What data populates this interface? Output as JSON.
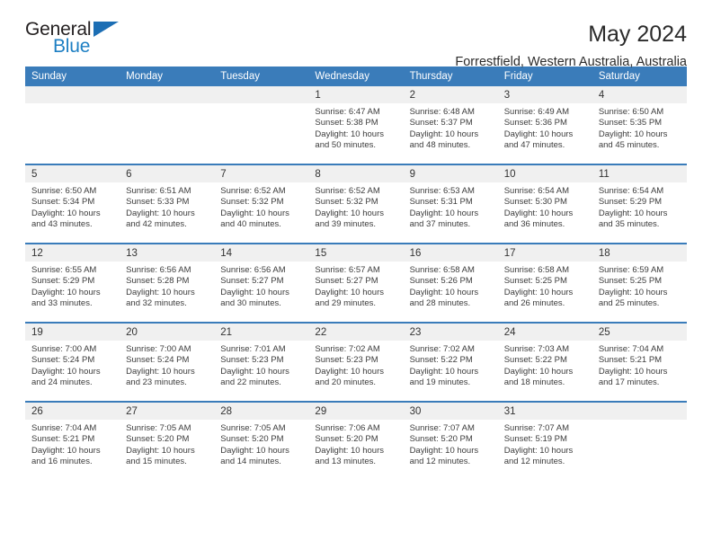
{
  "brand": {
    "name_part1": "General",
    "name_part2": "Blue",
    "triangle_color": "#1c6eb4",
    "blue_color": "#1d7fc3"
  },
  "header": {
    "title": "May 2024",
    "subtitle": "Forrestfield, Western Australia, Australia"
  },
  "theme": {
    "header_bar_color": "#3a7cba",
    "daynum_bg": "#f0f0f0"
  },
  "weekdays": [
    "Sunday",
    "Monday",
    "Tuesday",
    "Wednesday",
    "Thursday",
    "Friday",
    "Saturday"
  ],
  "labels": {
    "sunrise_prefix": "Sunrise:",
    "sunset_prefix": "Sunset:",
    "daylight_prefix": "Daylight:"
  },
  "weeks": [
    [
      {
        "day": "",
        "empty": true
      },
      {
        "day": "",
        "empty": true
      },
      {
        "day": "",
        "empty": true
      },
      {
        "day": "1",
        "sunrise": "Sunrise: 6:47 AM",
        "sunset": "Sunset: 5:38 PM",
        "daylight_line1": "Daylight: 10 hours",
        "daylight_line2": "and 50 minutes."
      },
      {
        "day": "2",
        "sunrise": "Sunrise: 6:48 AM",
        "sunset": "Sunset: 5:37 PM",
        "daylight_line1": "Daylight: 10 hours",
        "daylight_line2": "and 48 minutes."
      },
      {
        "day": "3",
        "sunrise": "Sunrise: 6:49 AM",
        "sunset": "Sunset: 5:36 PM",
        "daylight_line1": "Daylight: 10 hours",
        "daylight_line2": "and 47 minutes."
      },
      {
        "day": "4",
        "sunrise": "Sunrise: 6:50 AM",
        "sunset": "Sunset: 5:35 PM",
        "daylight_line1": "Daylight: 10 hours",
        "daylight_line2": "and 45 minutes."
      }
    ],
    [
      {
        "day": "5",
        "sunrise": "Sunrise: 6:50 AM",
        "sunset": "Sunset: 5:34 PM",
        "daylight_line1": "Daylight: 10 hours",
        "daylight_line2": "and 43 minutes."
      },
      {
        "day": "6",
        "sunrise": "Sunrise: 6:51 AM",
        "sunset": "Sunset: 5:33 PM",
        "daylight_line1": "Daylight: 10 hours",
        "daylight_line2": "and 42 minutes."
      },
      {
        "day": "7",
        "sunrise": "Sunrise: 6:52 AM",
        "sunset": "Sunset: 5:32 PM",
        "daylight_line1": "Daylight: 10 hours",
        "daylight_line2": "and 40 minutes."
      },
      {
        "day": "8",
        "sunrise": "Sunrise: 6:52 AM",
        "sunset": "Sunset: 5:32 PM",
        "daylight_line1": "Daylight: 10 hours",
        "daylight_line2": "and 39 minutes."
      },
      {
        "day": "9",
        "sunrise": "Sunrise: 6:53 AM",
        "sunset": "Sunset: 5:31 PM",
        "daylight_line1": "Daylight: 10 hours",
        "daylight_line2": "and 37 minutes."
      },
      {
        "day": "10",
        "sunrise": "Sunrise: 6:54 AM",
        "sunset": "Sunset: 5:30 PM",
        "daylight_line1": "Daylight: 10 hours",
        "daylight_line2": "and 36 minutes."
      },
      {
        "day": "11",
        "sunrise": "Sunrise: 6:54 AM",
        "sunset": "Sunset: 5:29 PM",
        "daylight_line1": "Daylight: 10 hours",
        "daylight_line2": "and 35 minutes."
      }
    ],
    [
      {
        "day": "12",
        "sunrise": "Sunrise: 6:55 AM",
        "sunset": "Sunset: 5:29 PM",
        "daylight_line1": "Daylight: 10 hours",
        "daylight_line2": "and 33 minutes."
      },
      {
        "day": "13",
        "sunrise": "Sunrise: 6:56 AM",
        "sunset": "Sunset: 5:28 PM",
        "daylight_line1": "Daylight: 10 hours",
        "daylight_line2": "and 32 minutes."
      },
      {
        "day": "14",
        "sunrise": "Sunrise: 6:56 AM",
        "sunset": "Sunset: 5:27 PM",
        "daylight_line1": "Daylight: 10 hours",
        "daylight_line2": "and 30 minutes."
      },
      {
        "day": "15",
        "sunrise": "Sunrise: 6:57 AM",
        "sunset": "Sunset: 5:27 PM",
        "daylight_line1": "Daylight: 10 hours",
        "daylight_line2": "and 29 minutes."
      },
      {
        "day": "16",
        "sunrise": "Sunrise: 6:58 AM",
        "sunset": "Sunset: 5:26 PM",
        "daylight_line1": "Daylight: 10 hours",
        "daylight_line2": "and 28 minutes."
      },
      {
        "day": "17",
        "sunrise": "Sunrise: 6:58 AM",
        "sunset": "Sunset: 5:25 PM",
        "daylight_line1": "Daylight: 10 hours",
        "daylight_line2": "and 26 minutes."
      },
      {
        "day": "18",
        "sunrise": "Sunrise: 6:59 AM",
        "sunset": "Sunset: 5:25 PM",
        "daylight_line1": "Daylight: 10 hours",
        "daylight_line2": "and 25 minutes."
      }
    ],
    [
      {
        "day": "19",
        "sunrise": "Sunrise: 7:00 AM",
        "sunset": "Sunset: 5:24 PM",
        "daylight_line1": "Daylight: 10 hours",
        "daylight_line2": "and 24 minutes."
      },
      {
        "day": "20",
        "sunrise": "Sunrise: 7:00 AM",
        "sunset": "Sunset: 5:24 PM",
        "daylight_line1": "Daylight: 10 hours",
        "daylight_line2": "and 23 minutes."
      },
      {
        "day": "21",
        "sunrise": "Sunrise: 7:01 AM",
        "sunset": "Sunset: 5:23 PM",
        "daylight_line1": "Daylight: 10 hours",
        "daylight_line2": "and 22 minutes."
      },
      {
        "day": "22",
        "sunrise": "Sunrise: 7:02 AM",
        "sunset": "Sunset: 5:23 PM",
        "daylight_line1": "Daylight: 10 hours",
        "daylight_line2": "and 20 minutes."
      },
      {
        "day": "23",
        "sunrise": "Sunrise: 7:02 AM",
        "sunset": "Sunset: 5:22 PM",
        "daylight_line1": "Daylight: 10 hours",
        "daylight_line2": "and 19 minutes."
      },
      {
        "day": "24",
        "sunrise": "Sunrise: 7:03 AM",
        "sunset": "Sunset: 5:22 PM",
        "daylight_line1": "Daylight: 10 hours",
        "daylight_line2": "and 18 minutes."
      },
      {
        "day": "25",
        "sunrise": "Sunrise: 7:04 AM",
        "sunset": "Sunset: 5:21 PM",
        "daylight_line1": "Daylight: 10 hours",
        "daylight_line2": "and 17 minutes."
      }
    ],
    [
      {
        "day": "26",
        "sunrise": "Sunrise: 7:04 AM",
        "sunset": "Sunset: 5:21 PM",
        "daylight_line1": "Daylight: 10 hours",
        "daylight_line2": "and 16 minutes."
      },
      {
        "day": "27",
        "sunrise": "Sunrise: 7:05 AM",
        "sunset": "Sunset: 5:20 PM",
        "daylight_line1": "Daylight: 10 hours",
        "daylight_line2": "and 15 minutes."
      },
      {
        "day": "28",
        "sunrise": "Sunrise: 7:05 AM",
        "sunset": "Sunset: 5:20 PM",
        "daylight_line1": "Daylight: 10 hours",
        "daylight_line2": "and 14 minutes."
      },
      {
        "day": "29",
        "sunrise": "Sunrise: 7:06 AM",
        "sunset": "Sunset: 5:20 PM",
        "daylight_line1": "Daylight: 10 hours",
        "daylight_line2": "and 13 minutes."
      },
      {
        "day": "30",
        "sunrise": "Sunrise: 7:07 AM",
        "sunset": "Sunset: 5:20 PM",
        "daylight_line1": "Daylight: 10 hours",
        "daylight_line2": "and 12 minutes."
      },
      {
        "day": "31",
        "sunrise": "Sunrise: 7:07 AM",
        "sunset": "Sunset: 5:19 PM",
        "daylight_line1": "Daylight: 10 hours",
        "daylight_line2": "and 12 minutes."
      },
      {
        "day": "",
        "empty": true
      }
    ]
  ]
}
